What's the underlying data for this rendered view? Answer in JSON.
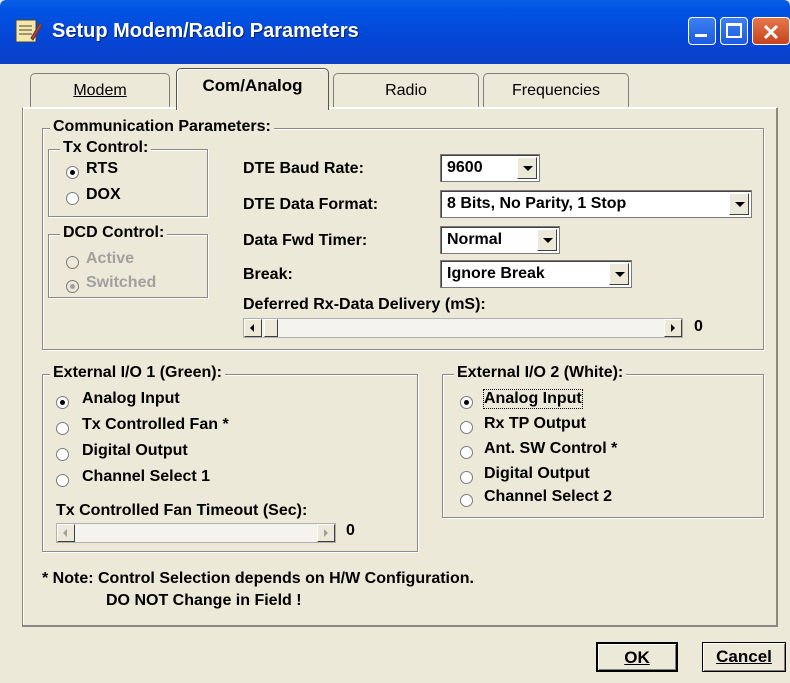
{
  "window": {
    "title": "Setup Modem/Radio Parameters"
  },
  "tabs": [
    "Modem",
    "Com/Analog",
    "Radio",
    "Frequencies"
  ],
  "comm": {
    "legend": "Communication Parameters:",
    "tx_control": {
      "legend": "Tx Control:",
      "options": [
        "RTS",
        "DOX"
      ],
      "selected": "RTS"
    },
    "dcd_control": {
      "legend": "DCD Control:",
      "options": [
        "Active",
        "Switched"
      ],
      "selected": "Switched"
    },
    "baud_label": "DTE Baud Rate:",
    "baud_value": "9600",
    "format_label": "DTE Data Format:",
    "format_value": "8 Bits, No Parity, 1 Stop",
    "fwd_label": "Data Fwd Timer:",
    "fwd_value": "Normal",
    "break_label": "Break:",
    "break_value": "Ignore Break",
    "deferred_label": "Deferred Rx-Data Delivery (mS):",
    "deferred_value": "0"
  },
  "io1": {
    "legend": "External I/O 1 (Green):",
    "options": [
      "Analog Input",
      "Tx Controlled Fan *",
      "Digital Output",
      "Channel Select 1"
    ],
    "selected": "Analog Input",
    "fan_timeout_label": "Tx Controlled Fan Timeout (Sec):",
    "fan_timeout_value": "0"
  },
  "io2": {
    "legend": "External I/O 2 (White):",
    "options": [
      "Analog Input",
      "Rx TP Output",
      "Ant. SW Control *",
      "Digital Output",
      "Channel Select 2"
    ],
    "selected": "Analog Input"
  },
  "note": {
    "line1": "* Note:  Control Selection depends on H/W Configuration.",
    "line2": "DO NOT Change in Field !"
  },
  "buttons": {
    "ok": "OK",
    "cancel": "Cancel"
  }
}
